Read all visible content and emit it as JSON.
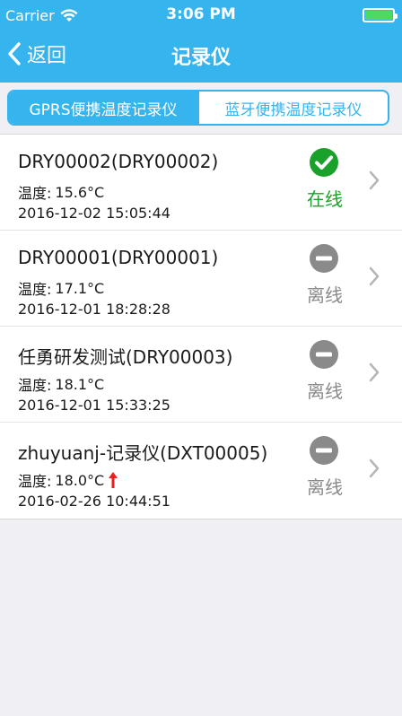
{
  "status_bar": {
    "carrier": "Carrier",
    "time": "3:06 PM",
    "battery_level": 1.0
  },
  "nav": {
    "back_label": "返回",
    "title": "记录仪"
  },
  "segment": {
    "tabs": [
      {
        "label": "GPRS便携温度记录仪",
        "active": true
      },
      {
        "label": "蓝牙便携温度记录仪",
        "active": false
      }
    ]
  },
  "devices": [
    {
      "name": "DRY00002(DRY00002)",
      "temp_label": "温度:",
      "temp": "15.6°C",
      "time": "2016-12-02 15:05:44",
      "status": "在线",
      "state": "online",
      "trend": ""
    },
    {
      "name": "DRY00001(DRY00001)",
      "temp_label": "温度:",
      "temp": "17.1°C",
      "time": "2016-12-01 18:28:28",
      "status": "离线",
      "state": "offline",
      "trend": ""
    },
    {
      "name": "任勇研发测试(DRY00003)",
      "temp_label": "温度:",
      "temp": "18.1°C",
      "time": "2016-12-01 15:33:25",
      "status": "离线",
      "state": "offline",
      "trend": ""
    },
    {
      "name": "zhuyuanj-记录仪(DXT00005)",
      "temp_label": "温度:",
      "temp": "18.0°C",
      "time": "2016-02-26 10:44:51",
      "status": "离线",
      "state": "offline",
      "trend": "up"
    }
  ],
  "colors": {
    "header": "#35b4ee",
    "online": "#1aa12c",
    "offline": "#8a8a8a",
    "trend_up": "#e82020"
  }
}
